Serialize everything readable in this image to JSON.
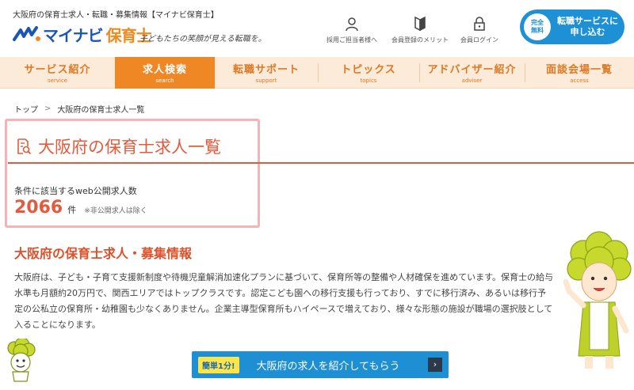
{
  "header": {
    "tagline": "大阪府の保育士求人・転職・募集情報【マイナビ保育士】",
    "logo_word": "マイナビ",
    "logo_sub": "保育士",
    "catchphrase": "子どもたちの笑顔が見える転職を。",
    "utility_links": [
      {
        "label": "採用ご担当者様へ",
        "icon": "person-icon"
      },
      {
        "label": "会員登録のメリット",
        "icon": "beginner-mark-icon"
      },
      {
        "label": "会員ログイン",
        "icon": "lock-icon"
      }
    ],
    "cta": {
      "badge_line1": "完全",
      "badge_line2": "無料",
      "line1": "転職サービスに",
      "line2": "申し込む"
    }
  },
  "nav": [
    {
      "label": "サービス紹介",
      "sub": "service",
      "active": false
    },
    {
      "label": "求人検索",
      "sub": "search",
      "active": true
    },
    {
      "label": "転職サポート",
      "sub": "support",
      "active": false
    },
    {
      "label": "トピックス",
      "sub": "topics",
      "active": false
    },
    {
      "label": "アドバイザー紹介",
      "sub": "adviser",
      "active": false
    },
    {
      "label": "面談会場一覧",
      "sub": "access",
      "active": false
    }
  ],
  "breadcrumb": {
    "home": "トップ",
    "separator": ">",
    "current": "大阪府の保育士求人一覧"
  },
  "main": {
    "page_title": "大阪府の保育士求人一覧",
    "count_label": "条件に該当するweb公開求人数",
    "count_value": "2066",
    "count_unit": "件",
    "count_note": "※非公開求人は除く",
    "section_title": "大阪府の保育士求人・募集情報",
    "body_text": "大阪府は、子ども・子育て支援新制度や待機児童解消加速化プランに基づいて、保育所等の整備や人材確保を進めています。保育士の給与水準も月額約20万円で、関西エリアではトップクラスです。認定こども園への移行支援も行っており、すでに移行済み、あるいは移行予定の公私立の保育所・幼稚園も少なくありません。企業主導型保育所もハイペースで増えており、様々な形態の施設が職場の選択肢として入ることになります。"
  },
  "bottom_cta": {
    "badge": "簡単1分!",
    "label": "大阪府の求人を紹介してもらう",
    "arrow": "›"
  },
  "colors": {
    "brand_blue": "#1a56b8",
    "brand_orange": "#ef8725",
    "accent_red": "#e55a3c",
    "cta_blue": "#1e90d6",
    "nav_bg": "#fdebd9"
  }
}
